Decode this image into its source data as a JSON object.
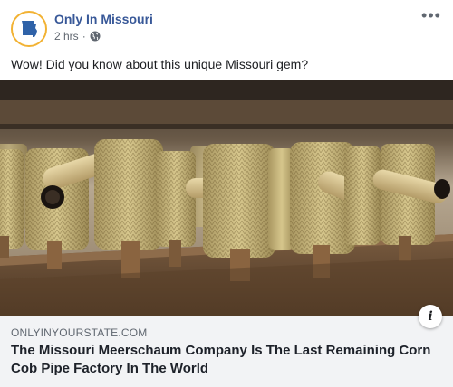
{
  "post": {
    "page_name": "Only In Missouri",
    "time": "2 hrs",
    "separator": "·",
    "audience_icon": "globe-icon",
    "more_icon": "ellipsis-icon",
    "more_label": "•••",
    "text": "Wow! Did you know about this unique Missouri gem?"
  },
  "link": {
    "domain": "ONLYINYOURSTATE.COM",
    "title": "The Missouri Meerschaum Company Is The Last Remaining Corn Cob Pipe Factory In The World",
    "info_label": "i",
    "image_subject": "corn-cob-pipes-on-drying-rack"
  },
  "colors": {
    "page_name": "#385898",
    "caption_bg": "#f2f3f5",
    "avatar_ring": "#f2b233",
    "avatar_state": "#2f62a8"
  }
}
